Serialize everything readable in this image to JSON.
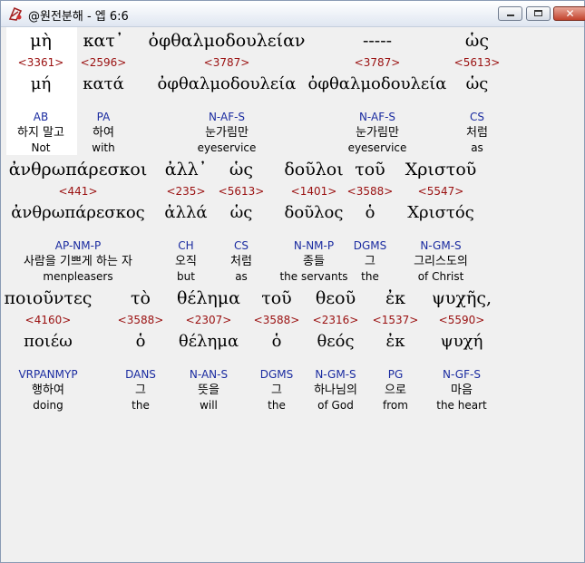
{
  "window": {
    "title": "@원전분해 - 엡 6:6",
    "minimize_icon": "minimize-icon",
    "maximize_icon": "maximize-icon",
    "close_icon": "close-icon",
    "close_glyph": "✕"
  },
  "colors": {
    "strong": "#9a1010",
    "parse": "#1a2ba0",
    "highlight": "#ffffff",
    "background": "#f0f0f0"
  },
  "rows": [
    [
      {
        "greek": "μὴ",
        "strong": "<3361>",
        "lemma": "μή",
        "parse": "AB",
        "kor": "하지 말고",
        "eng": "Not"
      },
      {
        "greek": "κατ᾽",
        "strong": "<2596>",
        "lemma": "κατά",
        "parse": "PA",
        "kor": "하여",
        "eng": "with"
      },
      {
        "greek": "ὀφθαλμοδουλείαν",
        "strong": "<3787>",
        "lemma": "ὀφθαλμοδουλεία",
        "parse": "N-AF-S",
        "kor": "눈가림만",
        "eng": "eyeservice"
      },
      {
        "greek": "-----",
        "strong": "<3787>",
        "lemma": "ὀφθαλμοδουλεία",
        "parse": "N-AF-S",
        "kor": "눈가림만",
        "eng": "eyeservice"
      },
      {
        "greek": "ὡς",
        "strong": "<5613>",
        "lemma": "ὡς",
        "parse": "CS",
        "kor": "처럼",
        "eng": "as"
      }
    ],
    [
      {
        "greek": "ἀνθρωπάρεσκοι",
        "strong": "<441>",
        "lemma": "ἀνθρωπάρεσκος",
        "parse": "AP-NM-P",
        "kor": "사람을 기쁘게 하는 자",
        "eng": "menpleasers"
      },
      {
        "greek": "ἀλλ᾽",
        "strong": "<235>",
        "lemma": "ἀλλά",
        "parse": "CH",
        "kor": "오직",
        "eng": "but"
      },
      {
        "greek": "ὡς",
        "strong": "<5613>",
        "lemma": "ὡς",
        "parse": "CS",
        "kor": "처럼",
        "eng": "as"
      },
      {
        "greek": "δοῦλοι",
        "strong": "<1401>",
        "lemma": "δοῦλος",
        "parse": "N-NM-P",
        "kor": "종들",
        "eng": "the servants"
      },
      {
        "greek": "τοῦ",
        "strong": "<3588>",
        "lemma": "ὁ",
        "parse": "DGMS",
        "kor": "그",
        "eng": "the"
      },
      {
        "greek": "Χριστοῦ",
        "strong": "<5547>",
        "lemma": "Χριστός",
        "parse": "N-GM-S",
        "kor": "그리스도의",
        "eng": "of Christ"
      }
    ],
    [
      {
        "greek": "ποιοῦντες",
        "strong": "<4160>",
        "lemma": "ποιέω",
        "parse": "VRPANMYP",
        "kor": "행하여",
        "eng": "doing"
      },
      {
        "greek": "τὸ",
        "strong": "<3588>",
        "lemma": "ὁ",
        "parse": "DANS",
        "kor": "그",
        "eng": "the"
      },
      {
        "greek": "θέλημα",
        "strong": "<2307>",
        "lemma": "θέλημα",
        "parse": "N-AN-S",
        "kor": "뜻을",
        "eng": "will"
      },
      {
        "greek": "τοῦ",
        "strong": "<3588>",
        "lemma": "ὁ",
        "parse": "DGMS",
        "kor": "그",
        "eng": "the"
      },
      {
        "greek": "θεοῦ",
        "strong": "<2316>",
        "lemma": "θεός",
        "parse": "N-GM-S",
        "kor": "하나님의",
        "eng": "of God"
      },
      {
        "greek": "ἐκ",
        "strong": "<1537>",
        "lemma": "ἐκ",
        "parse": "PG",
        "kor": "으로",
        "eng": "from"
      },
      {
        "greek": "ψυχῆς,",
        "strong": "<5590>",
        "lemma": "ψυχή",
        "parse": "N-GF-S",
        "kor": "마음",
        "eng": "the heart"
      }
    ]
  ]
}
